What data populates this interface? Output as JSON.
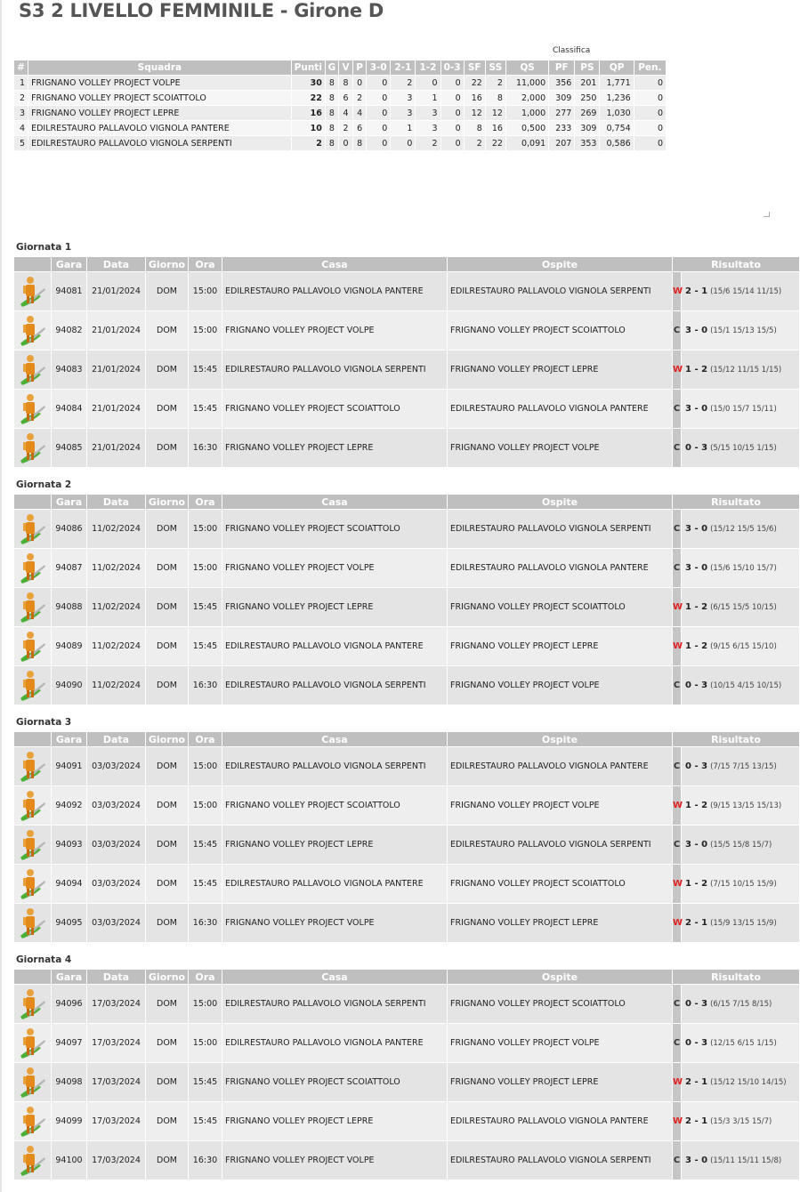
{
  "title": "S3 2 LIVELLO FEMMINILE - Girone D",
  "classifica_label": "Classifica",
  "standings": {
    "headers": [
      "#",
      "Squadra",
      "Punti",
      "G",
      "V",
      "P",
      "3-0",
      "2-1",
      "1-2",
      "0-3",
      "SF",
      "SS",
      "QS",
      "PF",
      "PS",
      "QP",
      "Pen."
    ],
    "rows": [
      [
        "1",
        "FRIGNANO VOLLEY PROJECT VOLPE",
        "30",
        "8",
        "8",
        "0",
        "0",
        "2",
        "0",
        "0",
        "22",
        "2",
        "11,000",
        "356",
        "201",
        "1,771",
        "0"
      ],
      [
        "2",
        "FRIGNANO VOLLEY PROJECT SCOIATTOLO",
        "22",
        "8",
        "6",
        "2",
        "0",
        "3",
        "1",
        "0",
        "16",
        "8",
        "2,000",
        "309",
        "250",
        "1,236",
        "0"
      ],
      [
        "3",
        "FRIGNANO VOLLEY PROJECT LEPRE",
        "16",
        "8",
        "4",
        "4",
        "0",
        "3",
        "3",
        "0",
        "12",
        "12",
        "1,000",
        "277",
        "269",
        "1,030",
        "0"
      ],
      [
        "4",
        "EDILRESTAURO PALLAVOLO VIGNOLA PANTERE",
        "10",
        "8",
        "2",
        "6",
        "0",
        "1",
        "3",
        "0",
        "8",
        "16",
        "0,500",
        "233",
        "309",
        "0,754",
        "0"
      ],
      [
        "5",
        "EDILRESTAURO PALLAVOLO VIGNOLA SERPENTI",
        "2",
        "8",
        "0",
        "8",
        "0",
        "0",
        "2",
        "0",
        "2",
        "22",
        "0,091",
        "207",
        "353",
        "0,586",
        "0"
      ]
    ]
  },
  "match_headers": [
    "",
    "Gara",
    "Data",
    "Giorno",
    "Ora",
    "Casa",
    "Ospite",
    "Risultato"
  ],
  "rounds": [
    {
      "title": "Giornata 1",
      "matches": [
        {
          "gara": "94081",
          "data": "21/01/2024",
          "giorno": "DOM",
          "ora": "15:00",
          "casa": "EDILRESTAURO PALLAVOLO VIGNOLA PANTERE",
          "ospite": "EDILRESTAURO PALLAVOLO VIGNOLA SERPENTI",
          "flag": "W",
          "score": "2 - 1",
          "partials": "(15/6 15/14 11/15)"
        },
        {
          "gara": "94082",
          "data": "21/01/2024",
          "giorno": "DOM",
          "ora": "15:00",
          "casa": "FRIGNANO VOLLEY PROJECT VOLPE",
          "ospite": "FRIGNANO VOLLEY PROJECT SCOIATTOLO",
          "flag": "C",
          "score": "3 - 0",
          "partials": "(15/1 15/13 15/5)"
        },
        {
          "gara": "94083",
          "data": "21/01/2024",
          "giorno": "DOM",
          "ora": "15:45",
          "casa": "EDILRESTAURO PALLAVOLO VIGNOLA SERPENTI",
          "ospite": "FRIGNANO VOLLEY PROJECT LEPRE",
          "flag": "W",
          "score": "1 - 2",
          "partials": "(15/12 11/15 1/15)"
        },
        {
          "gara": "94084",
          "data": "21/01/2024",
          "giorno": "DOM",
          "ora": "15:45",
          "casa": "FRIGNANO VOLLEY PROJECT SCOIATTOLO",
          "ospite": "EDILRESTAURO PALLAVOLO VIGNOLA PANTERE",
          "flag": "C",
          "score": "3 - 0",
          "partials": "(15/0 15/7 15/11)"
        },
        {
          "gara": "94085",
          "data": "21/01/2024",
          "giorno": "DOM",
          "ora": "16:30",
          "casa": "FRIGNANO VOLLEY PROJECT LEPRE",
          "ospite": "FRIGNANO VOLLEY PROJECT VOLPE",
          "flag": "C",
          "score": "0 - 3",
          "partials": "(5/15 10/15 1/15)"
        }
      ]
    },
    {
      "title": "Giornata 2",
      "matches": [
        {
          "gara": "94086",
          "data": "11/02/2024",
          "giorno": "DOM",
          "ora": "15:00",
          "casa": "FRIGNANO VOLLEY PROJECT SCOIATTOLO",
          "ospite": "EDILRESTAURO PALLAVOLO VIGNOLA SERPENTI",
          "flag": "C",
          "score": "3 - 0",
          "partials": "(15/12 15/5 15/6)"
        },
        {
          "gara": "94087",
          "data": "11/02/2024",
          "giorno": "DOM",
          "ora": "15:00",
          "casa": "FRIGNANO VOLLEY PROJECT VOLPE",
          "ospite": "EDILRESTAURO PALLAVOLO VIGNOLA PANTERE",
          "flag": "C",
          "score": "3 - 0",
          "partials": "(15/6 15/10 15/7)"
        },
        {
          "gara": "94088",
          "data": "11/02/2024",
          "giorno": "DOM",
          "ora": "15:45",
          "casa": "FRIGNANO VOLLEY PROJECT LEPRE",
          "ospite": "FRIGNANO VOLLEY PROJECT SCOIATTOLO",
          "flag": "W",
          "score": "1 - 2",
          "partials": "(6/15 15/5 10/15)"
        },
        {
          "gara": "94089",
          "data": "11/02/2024",
          "giorno": "DOM",
          "ora": "15:45",
          "casa": "EDILRESTAURO PALLAVOLO VIGNOLA PANTERE",
          "ospite": "FRIGNANO VOLLEY PROJECT LEPRE",
          "flag": "W",
          "score": "1 - 2",
          "partials": "(9/15 6/15 15/10)"
        },
        {
          "gara": "94090",
          "data": "11/02/2024",
          "giorno": "DOM",
          "ora": "16:30",
          "casa": "EDILRESTAURO PALLAVOLO VIGNOLA SERPENTI",
          "ospite": "FRIGNANO VOLLEY PROJECT VOLPE",
          "flag": "C",
          "score": "0 - 3",
          "partials": "(10/15 4/15 10/15)"
        }
      ]
    },
    {
      "title": "Giornata 3",
      "matches": [
        {
          "gara": "94091",
          "data": "03/03/2024",
          "giorno": "DOM",
          "ora": "15:00",
          "casa": "EDILRESTAURO PALLAVOLO VIGNOLA SERPENTI",
          "ospite": "EDILRESTAURO PALLAVOLO VIGNOLA PANTERE",
          "flag": "C",
          "score": "0 - 3",
          "partials": "(7/15 7/15 13/15)"
        },
        {
          "gara": "94092",
          "data": "03/03/2024",
          "giorno": "DOM",
          "ora": "15:00",
          "casa": "FRIGNANO VOLLEY PROJECT SCOIATTOLO",
          "ospite": "FRIGNANO VOLLEY PROJECT VOLPE",
          "flag": "W",
          "score": "1 - 2",
          "partials": "(9/15 13/15 15/13)"
        },
        {
          "gara": "94093",
          "data": "03/03/2024",
          "giorno": "DOM",
          "ora": "15:45",
          "casa": "FRIGNANO VOLLEY PROJECT LEPRE",
          "ospite": "EDILRESTAURO PALLAVOLO VIGNOLA SERPENTI",
          "flag": "C",
          "score": "3 - 0",
          "partials": "(15/5 15/8 15/7)"
        },
        {
          "gara": "94094",
          "data": "03/03/2024",
          "giorno": "DOM",
          "ora": "15:45",
          "casa": "EDILRESTAURO PALLAVOLO VIGNOLA PANTERE",
          "ospite": "FRIGNANO VOLLEY PROJECT SCOIATTOLO",
          "flag": "W",
          "score": "1 - 2",
          "partials": "(7/15 10/15 15/9)"
        },
        {
          "gara": "94095",
          "data": "03/03/2024",
          "giorno": "DOM",
          "ora": "16:30",
          "casa": "FRIGNANO VOLLEY PROJECT VOLPE",
          "ospite": "FRIGNANO VOLLEY PROJECT LEPRE",
          "flag": "W",
          "score": "2 - 1",
          "partials": "(15/9 13/15 15/9)"
        }
      ]
    },
    {
      "title": "Giornata 4",
      "matches": [
        {
          "gara": "94096",
          "data": "17/03/2024",
          "giorno": "DOM",
          "ora": "15:00",
          "casa": "EDILRESTAURO PALLAVOLO VIGNOLA SERPENTI",
          "ospite": "FRIGNANO VOLLEY PROJECT SCOIATTOLO",
          "flag": "C",
          "score": "0 - 3",
          "partials": "(6/15 7/15 8/15)"
        },
        {
          "gara": "94097",
          "data": "17/03/2024",
          "giorno": "DOM",
          "ora": "15:00",
          "casa": "EDILRESTAURO PALLAVOLO VIGNOLA PANTERE",
          "ospite": "FRIGNANO VOLLEY PROJECT VOLPE",
          "flag": "C",
          "score": "0 - 3",
          "partials": "(12/15 6/15 1/15)"
        },
        {
          "gara": "94098",
          "data": "17/03/2024",
          "giorno": "DOM",
          "ora": "15:45",
          "casa": "FRIGNANO VOLLEY PROJECT SCOIATTOLO",
          "ospite": "FRIGNANO VOLLEY PROJECT LEPRE",
          "flag": "W",
          "score": "2 - 1",
          "partials": "(15/12 15/10 14/15)"
        },
        {
          "gara": "94099",
          "data": "17/03/2024",
          "giorno": "DOM",
          "ora": "15:45",
          "casa": "FRIGNANO VOLLEY PROJECT LEPRE",
          "ospite": "EDILRESTAURO PALLAVOLO VIGNOLA PANTERE",
          "flag": "W",
          "score": "2 - 1",
          "partials": "(15/3 3/15 15/7)"
        },
        {
          "gara": "94100",
          "data": "17/03/2024",
          "giorno": "DOM",
          "ora": "16:30",
          "casa": "FRIGNANO VOLLEY PROJECT VOLPE",
          "ospite": "EDILRESTAURO PALLAVOLO VIGNOLA SERPENTI",
          "flag": "C",
          "score": "3 - 0",
          "partials": "(15/11 15/11 15/8)"
        }
      ]
    }
  ],
  "icons": {
    "referee": "referee-icon",
    "corner": "corner-mark-icon"
  },
  "colors": {
    "header_bg": "#bfbfbf",
    "row_bg": "#e4e4e4",
    "win_flag": "#e02020",
    "flag_bg": "#c6c6c6"
  }
}
